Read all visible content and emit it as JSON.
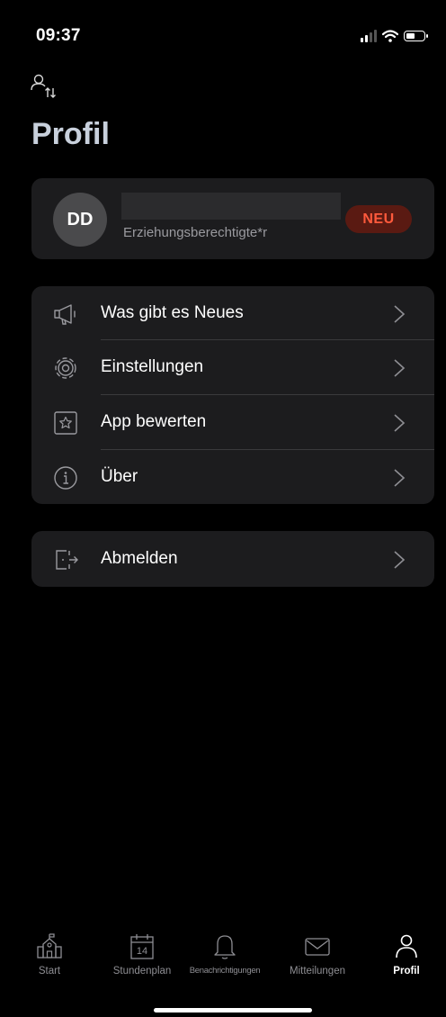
{
  "status_bar": {
    "time": "09:37"
  },
  "header": {
    "title": "Profil"
  },
  "profile": {
    "initials": "DD",
    "role": "Erziehungsberechtigte*r",
    "badge": "NEU"
  },
  "menu": {
    "items": [
      {
        "label": "Was gibt es Neues",
        "icon": "megaphone-icon"
      },
      {
        "label": "Einstellungen",
        "icon": "gear-icon"
      },
      {
        "label": "App bewerten",
        "icon": "star-icon"
      },
      {
        "label": "Über",
        "icon": "info-icon"
      }
    ]
  },
  "logout": {
    "label": "Abmelden",
    "icon": "logout-door-icon"
  },
  "tabbar": {
    "calendar_day": "14",
    "items": [
      {
        "label": "Start",
        "icon": "school-icon"
      },
      {
        "label": "Stundenplan",
        "icon": "calendar-icon"
      },
      {
        "label": "Benachrichtigungen",
        "icon": "bell-icon"
      },
      {
        "label": "Mitteilungen",
        "icon": "mail-icon"
      },
      {
        "label": "Profil",
        "icon": "person-icon",
        "active": true
      }
    ]
  },
  "colors": {
    "card": "#1c1c1e",
    "badge_bg": "#5a1a12",
    "badge_text": "#ff5a3c",
    "title": "#c8d0dc"
  }
}
